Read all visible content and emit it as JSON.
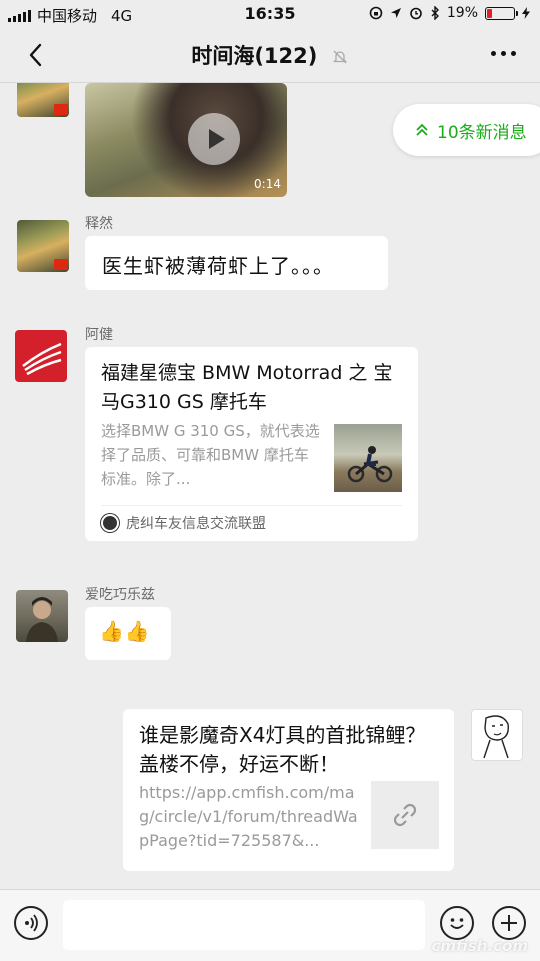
{
  "status_bar": {
    "carrier": "中国移动",
    "network": "4G",
    "time": "16:35",
    "battery_percent": "19%",
    "battery_level": 0.19,
    "battery_color": "#e22222"
  },
  "nav": {
    "title": "时间海(122)",
    "back_icon": "chevron-left-icon",
    "mute_icon": "bell-muted-icon",
    "more_icon": "more-dots-icon"
  },
  "new_messages": {
    "label": "10条新消息",
    "icon": "double-chevron-up-icon",
    "color": "#1aad19"
  },
  "messages": [
    {
      "type": "video",
      "duration": "0:14"
    },
    {
      "type": "text",
      "sender": "释然",
      "text": "医生虾被薄荷虾上了。。。"
    },
    {
      "type": "link",
      "sender": "阿健",
      "title": "福建星德宝 BMW Motorrad 之 宝马G310 GS 摩托车",
      "description": "选择BMW G 310 GS，就代表选择了品质、可靠和BMW 摩托车标准。除了...",
      "source": "虎纠车友信息交流联盟"
    },
    {
      "type": "emoji",
      "sender": "爱吃巧乐兹",
      "text": "👍👍"
    },
    {
      "type": "link",
      "sender": "me",
      "title": "谁是影魔奇X4灯具的首批锦鲤？盖楼不停，好运不断！",
      "description": "https://app.cmfish.com/mag/circle/v1/forum/threadWapPage?tid=725587&..."
    }
  ],
  "input_bar": {
    "voice_icon": "voice-icon",
    "emoji_icon": "emoji-icon",
    "plus_icon": "plus-icon"
  },
  "watermark": "cmfish.com"
}
